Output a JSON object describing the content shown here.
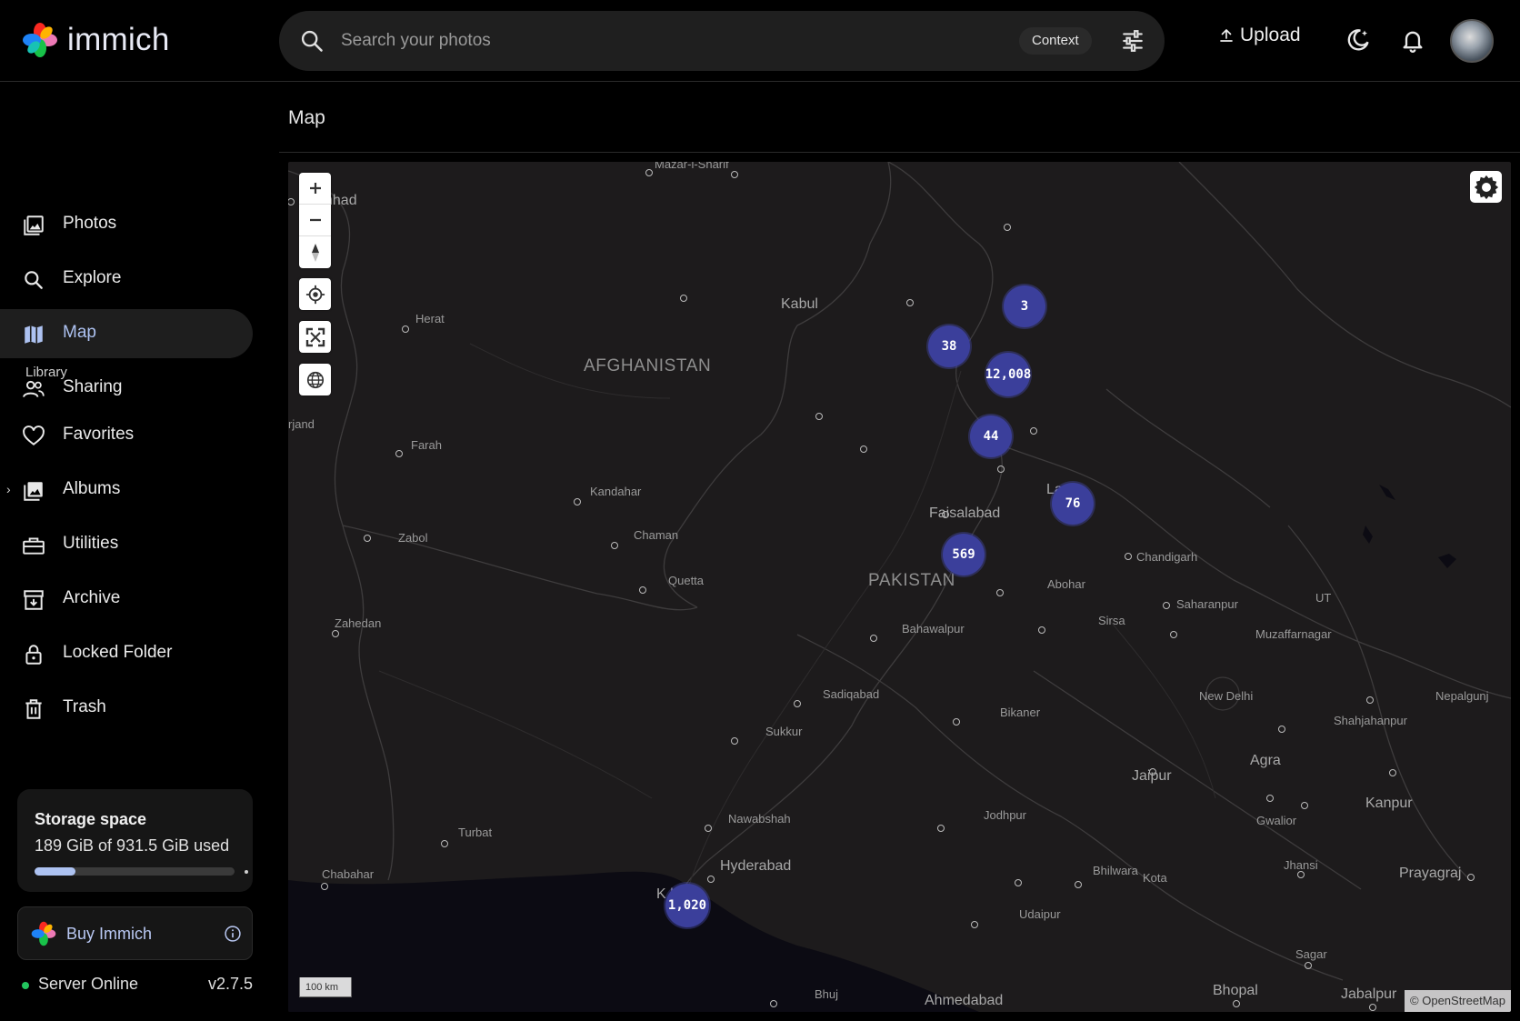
{
  "app": {
    "name": "immich"
  },
  "header": {
    "search_placeholder": "Search your photos",
    "context_label": "Context",
    "upload_label": "Upload"
  },
  "sidebar": {
    "items": [
      {
        "label": "Photos",
        "icon": "photos-icon"
      },
      {
        "label": "Explore",
        "icon": "search-icon"
      },
      {
        "label": "Map",
        "icon": "map-icon"
      },
      {
        "label": "Sharing",
        "icon": "people-icon"
      }
    ],
    "library_label": "Library",
    "library_items": [
      {
        "label": "Favorites",
        "icon": "heart-icon"
      },
      {
        "label": "Albums",
        "icon": "album-icon"
      },
      {
        "label": "Utilities",
        "icon": "toolbox-icon"
      },
      {
        "label": "Archive",
        "icon": "archive-icon"
      },
      {
        "label": "Locked Folder",
        "icon": "lock-icon"
      },
      {
        "label": "Trash",
        "icon": "trash-icon"
      }
    ],
    "storage": {
      "title": "Storage space",
      "usage": "189 GiB of 931.5 GiB used",
      "used_fraction": 0.203
    },
    "buy_label": "Buy Immich",
    "server_status": "Server Online",
    "version": "v2.7.5"
  },
  "page": {
    "title": "Map"
  },
  "map": {
    "scale_label": "100 km",
    "attribution": "© OpenStreetMap",
    "clusters": [
      "3",
      "38",
      "12,008",
      "44",
      "76",
      "569",
      "1,020"
    ],
    "labels": {
      "mazar": "Mazar-i-Sharif",
      "mashhad": "hhad",
      "kabul": "Kabul",
      "herat": "Herat",
      "afghanistan": "AFGHANISTAN",
      "birjand": "rjand",
      "farah": "Farah",
      "kandahar": "Kandahar",
      "zabol": "Zabol",
      "chaman": "Chaman",
      "quetta": "Quetta",
      "zahedan": "Zahedan",
      "faisalabad": "Faisalabad",
      "lahore": "La    re",
      "pakistan": "PAKISTAN",
      "chandigarh": "Chandigarh",
      "abohar": "Abohar",
      "ut": "UT",
      "saharanpur": "Saharanpur",
      "sirsa": "Sirsa",
      "muzaffarnagar": "Muzaffarnagar",
      "bahawalpur": "Bahawalpur",
      "newdelhi": "New Delhi",
      "nepalgunj": "Nepalgunj",
      "shahjahanpur": "Shahjahanpur",
      "sadiqabad": "Sadiqabad",
      "bikaner": "Bikaner",
      "sukkur": "Sukkur",
      "agra": "Agra",
      "jaipur": "Jaipur",
      "kanpur": "Kanpur",
      "turbat": "Turbat",
      "nawabshah": "Nawabshah",
      "jodhpur": "Jodhpur",
      "gwalior": "Gwalior",
      "chabahar": "Chabahar",
      "hyderabad": "Hyderabad",
      "jhansi": "Jhansi",
      "bhilwara": "Bhilwara",
      "kota": "Kota",
      "prayagraj": "Prayagraj",
      "karachi": "K     hi",
      "udaipur": "Udaipur",
      "sagar": "Sagar",
      "bhuj": "Bhuj",
      "ahmedabad": "Ahmedabad",
      "bhopal": "Bhopal",
      "jabalpur": "Jabalpur"
    }
  },
  "colors": {
    "accent": "#adc2f1",
    "cluster": "#3b3f9b",
    "map_bg": "#1d1b1c",
    "online": "#22c55e"
  }
}
